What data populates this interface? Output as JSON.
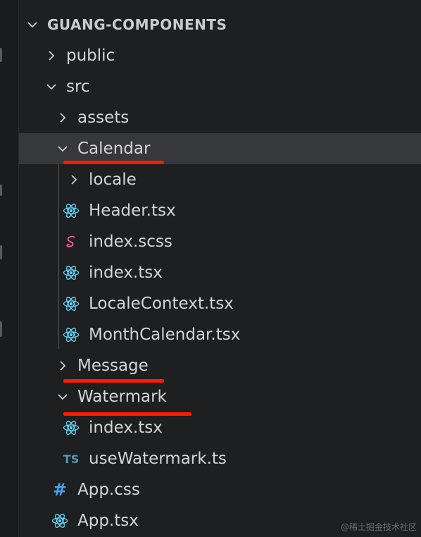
{
  "explorer": {
    "root_label": "GUANG-COMPONENTS",
    "items": [
      {
        "label": "public"
      },
      {
        "label": "src"
      },
      {
        "label": "assets"
      },
      {
        "label": "Calendar"
      },
      {
        "label": "locale"
      },
      {
        "label": "Header.tsx"
      },
      {
        "label": "index.scss"
      },
      {
        "label": "index.tsx"
      },
      {
        "label": "LocaleContext.tsx"
      },
      {
        "label": "MonthCalendar.tsx"
      },
      {
        "label": "Message"
      },
      {
        "label": "Watermark"
      },
      {
        "label": "index.tsx"
      },
      {
        "label": "useWatermark.ts"
      },
      {
        "label": "App.css"
      },
      {
        "label": "App.tsx"
      }
    ],
    "icons": {
      "react": "react-icon",
      "sass": "sass-icon",
      "typescript": "typescript-icon",
      "css": "css-hash-icon",
      "ts_glyph": "TS",
      "css_glyph": "#"
    }
  },
  "annotations": {
    "underlined": [
      "Calendar",
      "Message",
      "Watermark"
    ],
    "color": "#ff1a00"
  },
  "watermark_text": "@稀土掘金技术社区",
  "colors": {
    "background": "#1e1f21",
    "selected_row": "#37383c",
    "react": "#61dafb",
    "sass": "#f06292",
    "typescript": "#519aba",
    "css": "#42a5f5"
  }
}
